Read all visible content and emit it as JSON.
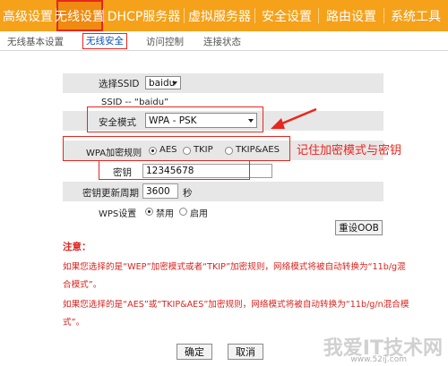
{
  "topnav": {
    "items": [
      {
        "label": "高级设置"
      },
      {
        "label": "无线设置"
      },
      {
        "label": "DHCP服务器"
      },
      {
        "label": "虚拟服务器"
      },
      {
        "label": "安全设置"
      },
      {
        "label": "路由设置"
      },
      {
        "label": "系统工具"
      }
    ],
    "selected_index": 1
  },
  "subnav": {
    "items": [
      {
        "label": "无线基本设置"
      },
      {
        "label": "无线安全"
      },
      {
        "label": "访问控制"
      },
      {
        "label": "连接状态"
      }
    ],
    "selected_index": 1
  },
  "form": {
    "ssid_label": "选择SSID",
    "ssid_value": "baidu",
    "ssid_info": "SSID -- “baidu”",
    "mode_label": "安全模式",
    "mode_value": "WPA - PSK",
    "cipher_label": "WPA加密规则",
    "cipher_options": [
      "AES",
      "TKIP",
      "TKIP&AES"
    ],
    "cipher_selected": "AES",
    "key_label": "密钥",
    "key_value": "12345678",
    "renew_label": "密钥更新周期",
    "renew_value": "3600",
    "renew_unit": "秒",
    "wps_label": "WPS设置",
    "wps_options": [
      "禁用",
      "启用"
    ],
    "wps_selected": "禁用",
    "reset_oob_label": "重设OOB"
  },
  "annotation": "记住加密模式与密钥",
  "notes": {
    "title": "注意：",
    "line1": "如果您选择的是“WEP”加密模式或者“TKIP”加密规则，网络模式将被自动转换为“11b/g混",
    "line2": "合模式”。",
    "line3": "如果您选择的是“AES”或“TKIP&AES”加密规则，网络模式将被自动转换为“11b/g/n混合模",
    "line4": "式”。"
  },
  "buttons": {
    "ok_label": "确定",
    "cancel_label": "取消"
  },
  "watermark": {
    "text": "我爱IT技术网",
    "url": "www.52ij.com"
  }
}
